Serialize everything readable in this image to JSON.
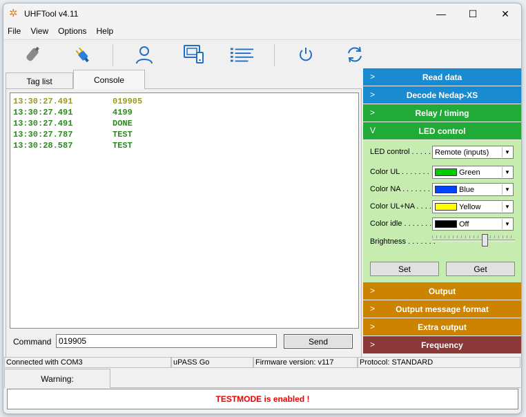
{
  "window": {
    "title": "UHFTool v4.11",
    "minimize": "—",
    "maximize": "☐",
    "close": "✕"
  },
  "menu": [
    "File",
    "View",
    "Options",
    "Help"
  ],
  "toolbar": {
    "icons": [
      "antenna-icon",
      "connect-plug-icon",
      "user-icon",
      "device-settings-icon",
      "list-icon",
      "power-icon",
      "refresh-icon"
    ]
  },
  "tabs": {
    "tag_list": "Tag list",
    "console": "Console"
  },
  "console": {
    "lines": [
      {
        "time": "13:30:27.491",
        "text": "019905",
        "color": "#9a9a1e"
      },
      {
        "time": "13:30:27.491",
        "text": "4199",
        "color": "#2a8a1e"
      },
      {
        "time": "13:30:27.491",
        "text": "DONE",
        "color": "#2a8a1e"
      },
      {
        "time": "13:30:27.787",
        "text": "TEST",
        "color": "#2a8a1e"
      },
      {
        "time": "13:30:28.587",
        "text": "TEST",
        "color": "#2a8a1e"
      }
    ]
  },
  "command": {
    "label": "Command",
    "value": "019905",
    "send": "Send"
  },
  "panel": {
    "bars": [
      {
        "label": "Read data",
        "chev": ">",
        "color": "#1a8bd0"
      },
      {
        "label": "Decode Nedap-XS",
        "chev": ">",
        "color": "#1a8bd0"
      },
      {
        "label": "Relay / timing",
        "chev": ">",
        "color": "#22aa38"
      },
      {
        "label": "LED control",
        "chev": "V",
        "color": "#22aa38"
      },
      {
        "label": "Output",
        "chev": ">",
        "color": "#cc8400"
      },
      {
        "label": "Output message format",
        "chev": ">",
        "color": "#cc8400"
      },
      {
        "label": "Extra output",
        "chev": ">",
        "color": "#cc8400"
      },
      {
        "label": "Frequency",
        "chev": ">",
        "color": "#8a3838"
      }
    ],
    "led": {
      "control_label": "LED control . . . . .",
      "control_value": "Remote (inputs)",
      "color_ul_label": "Color UL . . . . . . . .",
      "color_ul_value": "Green",
      "color_ul_swatch": "#00cc00",
      "color_na_label": "Color NA . . . . . . . .",
      "color_na_value": "Blue",
      "color_na_swatch": "#0044ff",
      "color_ulna_label": "Color UL+NA . . . . .",
      "color_ulna_value": "Yellow",
      "color_ulna_swatch": "#ffff00",
      "color_idle_label": "Color idle . . . . . . .",
      "color_idle_value": "Off",
      "color_idle_swatch": "#000000",
      "brightness_label": "Brightness . . . . . . .",
      "brightness_level": 0.65,
      "set": "Set",
      "get": "Get"
    }
  },
  "status": {
    "connection": "Connected with COM3",
    "device": "uPASS Go",
    "firmware": "Firmware version: v117",
    "protocol": "Protocol: STANDARD"
  },
  "warning": {
    "tab": "Warning:",
    "message": "TESTMODE is enabled !"
  }
}
